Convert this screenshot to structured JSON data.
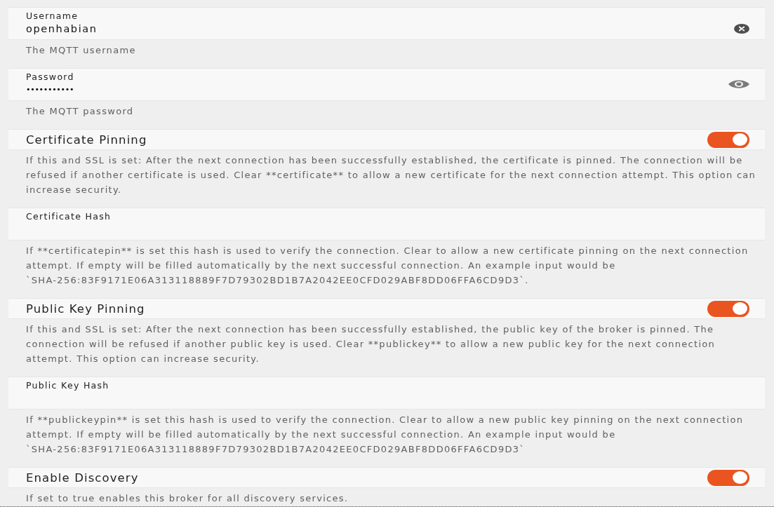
{
  "settings": [
    {
      "kind": "text",
      "label": "Username",
      "value": "openhabian",
      "help": "The MQTT username"
    },
    {
      "kind": "password",
      "label": "Password",
      "value": "•••••••••••",
      "help": "The MQTT password"
    },
    {
      "kind": "toggle",
      "label": "Certificate Pinning",
      "on": true,
      "help": "If this and SSL is set: After the next connection has been successfully established, the certificate is pinned. The connection will be refused if another certificate is used. Clear **certificate** to allow a new certificate for the next connection attempt. This option can increase security."
    },
    {
      "kind": "text",
      "label": "Certificate Hash",
      "help": "If **certificatepin** is set this hash is used to verify the connection. Clear to allow a new certificate pinning on the next connection attempt. If empty will be filled automatically by the next successful connection. An example input would be `SHA-256:83F9171E06A313118889F7D79302BD1B7A2042EE0CFD029ABF8DD06FFA6CD9D3`."
    },
    {
      "kind": "toggle",
      "label": "Public Key Pinning",
      "on": true,
      "help": "If this and SSL is set: After the next connection has been successfully established, the public key of the broker is pinned. The connection will be refused if another public key is used. Clear **publickey** to allow a new public key for the next connection attempt. This option can increase security."
    },
    {
      "kind": "text",
      "label": "Public Key Hash",
      "help": "If **publickeypin** is set this hash is used to verify the connection. Clear to allow a new public key pinning on the next connection attempt. If empty will be filled automatically by the next successful connection. An example input would be `SHA-256:83F9171E06A313118889F7D79302BD1B7A2042EE0CFD029ABF8DD06FFA6CD9D3`"
    },
    {
      "kind": "toggle",
      "label": "Enable Discovery",
      "on": true,
      "help": "If set to true enables this broker for all discovery services."
    }
  ]
}
